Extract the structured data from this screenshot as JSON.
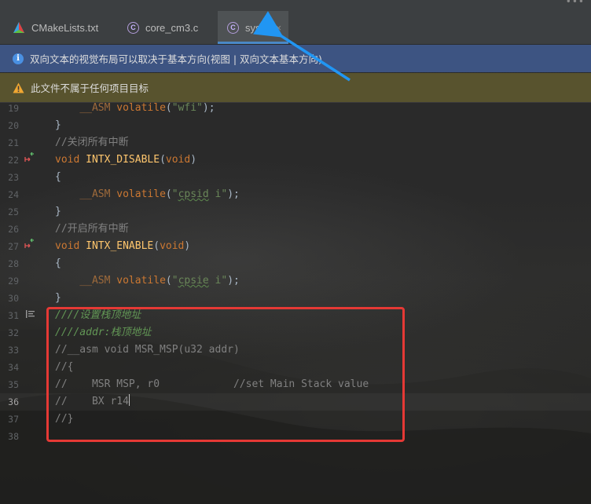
{
  "tabs": [
    {
      "label": "CMakeLists.txt",
      "icon": "cmake-icon",
      "active": false
    },
    {
      "label": "core_cm3.c",
      "icon": "c-file-icon",
      "active": false
    },
    {
      "label": "sys.c",
      "icon": "c-file-icon",
      "active": true,
      "close": "×"
    }
  ],
  "banners": {
    "info": "双向文本的视觉布局可以取决于基本方向(视图 | 双向文本基本方向)",
    "warning": "此文件不属于任何项目目标"
  },
  "colors": {
    "info_banner": "#3d5482",
    "warning_banner": "#58532e",
    "tab_underline": "#4a88c7",
    "annotation_red": "#e53935",
    "annotation_arrow": "#2196f3"
  },
  "editor": {
    "lines": {
      "l19": {
        "num": "19",
        "macro": "__ASM",
        "kw": "volatile",
        "open": "(",
        "str": "\"wfi\"",
        "close": ");"
      },
      "l20": {
        "num": "20",
        "text": "}"
      },
      "l21": {
        "num": "21",
        "comment": "//关闭所有中断"
      },
      "l22": {
        "num": "22",
        "kw": "void",
        "fn": "INTX_DISABLE",
        "open": "(",
        "param": "void",
        "close": ")"
      },
      "l23": {
        "num": "23",
        "text": "{"
      },
      "l24": {
        "num": "24",
        "macro": "__ASM",
        "kw": "volatile",
        "open": "(",
        "q1": "\"",
        "str": "cpsid",
        "rest": " i\"",
        "close": ");"
      },
      "l25": {
        "num": "25",
        "text": "}"
      },
      "l26": {
        "num": "26",
        "comment": "//开启所有中断"
      },
      "l27": {
        "num": "27",
        "kw": "void",
        "fn": "INTX_ENABLE",
        "open": "(",
        "param": "void",
        "close": ")"
      },
      "l28": {
        "num": "28",
        "text": "{"
      },
      "l29": {
        "num": "29",
        "macro": "__ASM",
        "kw": "volatile",
        "open": "(",
        "q1": "\"",
        "str": "cpsie",
        "rest": " i\"",
        "close": ");"
      },
      "l30": {
        "num": "30",
        "text": "}"
      },
      "l31": {
        "num": "31",
        "doc": "////设置栈顶地址"
      },
      "l32": {
        "num": "32",
        "doc_a": "////addr",
        "doc_b": ":栈顶地址"
      },
      "l33": {
        "num": "33",
        "comment": "//__asm void MSR_MSP(u32 addr)"
      },
      "l34": {
        "num": "34",
        "comment": "//{"
      },
      "l35": {
        "num": "35",
        "comment": "//    MSR MSP, r0            //set Main Stack value"
      },
      "l36": {
        "num": "36",
        "comment": "//    BX r14"
      },
      "l37": {
        "num": "37",
        "comment": "//}"
      },
      "l38": {
        "num": "38",
        "text": ""
      }
    }
  }
}
